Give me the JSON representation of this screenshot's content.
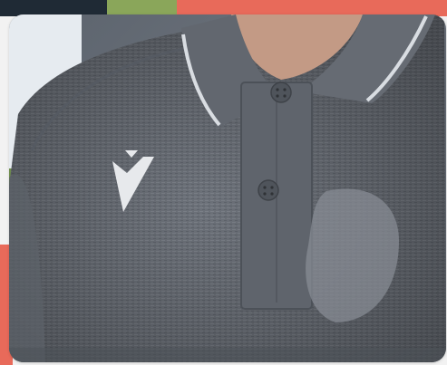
{
  "image": {
    "alt": "",
    "colors": {
      "shirt": "#6b7079",
      "shirt_dark": "#52575f",
      "collar_trim": "#d9dde2",
      "logo": "#e7e9ec",
      "skin": "#c29a84",
      "sky": "#e9eef3",
      "grass": "#6f8f4a",
      "accent_red": "#e86a5a",
      "accent_green": "#8aa65a"
    }
  }
}
